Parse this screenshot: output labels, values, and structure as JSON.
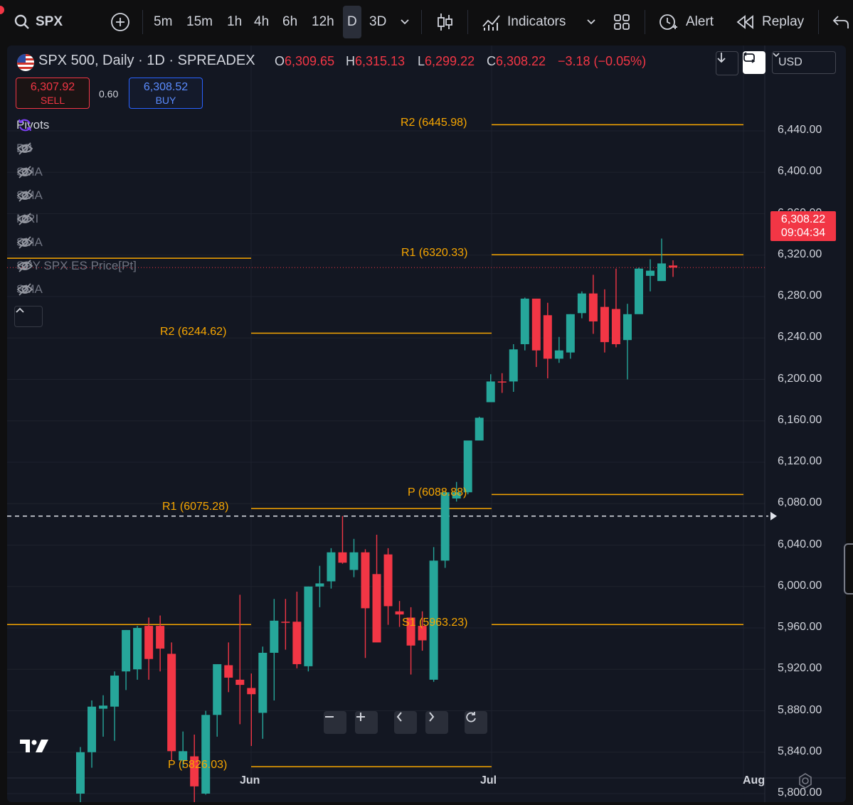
{
  "toolbar": {
    "symbol": "SPX",
    "intervals": [
      "5m",
      "15m",
      "1h",
      "4h",
      "6h",
      "12h",
      "D",
      "3D"
    ],
    "active_interval": "D",
    "indicators_label": "Indicators",
    "alert_label": "Alert",
    "replay_label": "Replay"
  },
  "legend": {
    "title": "SPX 500, Daily · 1D · SPREADEX",
    "open_key": "O",
    "open": "6,309.65",
    "high_key": "H",
    "high": "6,315.13",
    "low_key": "L",
    "low": "6,299.22",
    "close_key": "C",
    "close": "6,308.22",
    "change": "−3.18 (−0.05%)"
  },
  "trade": {
    "sell_price": "6,307.92",
    "sell_label": "SELL",
    "spread": "0.60",
    "buy_price": "6,308.52",
    "buy_label": "BUY"
  },
  "indicators": [
    {
      "label": "Pivots",
      "icon": "refresh-icon",
      "active": true
    },
    {
      "label": "BB",
      "icon": "eye-off-icon",
      "active": false
    },
    {
      "label": "SMA",
      "icon": "eye-off-icon",
      "active": false
    },
    {
      "label": "SMA",
      "icon": "eye-off-icon",
      "active": false
    },
    {
      "label": "MRI",
      "icon": "eye-off-icon",
      "active": false
    },
    {
      "label": "SMA",
      "icon": "eye-off-icon",
      "active": false
    },
    {
      "label": "SPY SPX ES Price[Pt]",
      "icon": "eye-off-icon",
      "active": false
    },
    {
      "label": "SMA",
      "icon": "eye-off-icon",
      "active": false
    }
  ],
  "currency": "USD",
  "price_tag": {
    "price": "6,308.22",
    "countdown": "09:04:34"
  },
  "colors": {
    "up": "#26a69a",
    "down": "#f23645",
    "pivot": "#f7a600",
    "background": "#131722"
  },
  "chart_data": {
    "type": "candlestick",
    "y_ticks": [
      5800,
      5840,
      5880,
      5920,
      5960,
      6000,
      6040,
      6080,
      6120,
      6160,
      6200,
      6240,
      6280,
      6320,
      6360,
      6400,
      6440
    ],
    "y_tick_labels": [
      "5,800.00",
      "5,840.00",
      "5,880.00",
      "5,920.00",
      "5,960.00",
      "6,000.00",
      "6,040.00",
      "6,080.00",
      "6,120.00",
      "6,160.00",
      "6,200.00",
      "6,240.00",
      "6,280.00",
      "6,320.00",
      "6,360.00",
      "6,400.00",
      "6,440.00"
    ],
    "ylim": [
      5780,
      6450
    ],
    "x_labels": [
      "Jun",
      "Jul",
      "Aug"
    ],
    "horizontal_line": 6068,
    "pivots": [
      {
        "label": "R2 (6445.98)",
        "value": 6445.98,
        "period": "Jul"
      },
      {
        "label": "R1 (6320.33)",
        "value": 6320.33,
        "period": "Jul"
      },
      {
        "label": "P (6088.88)",
        "value": 6088.88,
        "period": "Jul"
      },
      {
        "label": "S1 (5963.23)",
        "value": 5963.23,
        "period": "Jul"
      },
      {
        "label": "R2 (6244.62)",
        "value": 6244.62,
        "period": "Jun"
      },
      {
        "label": "R1 (6075.28)",
        "value": 6075.28,
        "period": "Jun"
      },
      {
        "label": "P (5826.03)",
        "value": 5826.03,
        "period": "Jun"
      },
      {
        "label": "",
        "value": 5963.23,
        "period": "May"
      },
      {
        "label": "",
        "value": 6317.0,
        "period": "May"
      }
    ],
    "candles": [
      {
        "o": 5800,
        "h": 5845,
        "l": 5781,
        "c": 5840
      },
      {
        "o": 5840,
        "h": 5890,
        "l": 5825,
        "c": 5884
      },
      {
        "o": 5882,
        "h": 5895,
        "l": 5855,
        "c": 5885
      },
      {
        "o": 5884,
        "h": 5918,
        "l": 5851,
        "c": 5914
      },
      {
        "o": 5918,
        "h": 5958,
        "l": 5900,
        "c": 5958
      },
      {
        "o": 5920,
        "h": 5962,
        "l": 5910,
        "c": 5960
      },
      {
        "o": 5962,
        "h": 5970,
        "l": 5910,
        "c": 5930
      },
      {
        "o": 5962,
        "h": 5972,
        "l": 5918,
        "c": 5940
      },
      {
        "o": 5935,
        "h": 5946,
        "l": 5832,
        "c": 5841
      },
      {
        "o": 5832,
        "h": 5860,
        "l": 5825,
        "c": 5841
      },
      {
        "o": 5836,
        "h": 5857,
        "l": 5781,
        "c": 5807
      },
      {
        "o": 5800,
        "h": 5880,
        "l": 5799,
        "c": 5876
      },
      {
        "o": 5876,
        "h": 5925,
        "l": 5855,
        "c": 5925
      },
      {
        "o": 5924,
        "h": 5946,
        "l": 5898,
        "c": 5912
      },
      {
        "o": 5910,
        "h": 5992,
        "l": 5867,
        "c": 5905
      },
      {
        "o": 5902,
        "h": 5916,
        "l": 5846,
        "c": 5896
      },
      {
        "o": 5878,
        "h": 5942,
        "l": 5853,
        "c": 5936
      },
      {
        "o": 5936,
        "h": 5988,
        "l": 5890,
        "c": 5967
      },
      {
        "o": 5966,
        "h": 5988,
        "l": 5939,
        "c": 5965
      },
      {
        "o": 5966,
        "h": 5995,
        "l": 5921,
        "c": 5925
      },
      {
        "o": 5923,
        "h": 6000,
        "l": 5918,
        "c": 6000
      },
      {
        "o": 6000,
        "h": 6020,
        "l": 5980,
        "c": 6003
      },
      {
        "o": 6005,
        "h": 6037,
        "l": 5998,
        "c": 6033
      },
      {
        "o": 6033,
        "h": 6068,
        "l": 6022,
        "c": 6023
      },
      {
        "o": 6016,
        "h": 6046,
        "l": 6009,
        "c": 6033
      },
      {
        "o": 6033,
        "h": 6036,
        "l": 5931,
        "c": 5979
      },
      {
        "o": 6012,
        "h": 6050,
        "l": 5982,
        "c": 5946
      },
      {
        "o": 6031,
        "h": 6037,
        "l": 5963,
        "c": 5981
      },
      {
        "o": 5976,
        "h": 5986,
        "l": 5961,
        "c": 5973
      },
      {
        "o": 5970,
        "h": 5980,
        "l": 5915,
        "c": 5943
      },
      {
        "o": 5962,
        "h": 5976,
        "l": 5938,
        "c": 5948
      },
      {
        "o": 5910,
        "h": 6038,
        "l": 5908,
        "c": 6025
      },
      {
        "o": 6025,
        "h": 6089,
        "l": 6018,
        "c": 6091
      },
      {
        "o": 6085,
        "h": 6101,
        "l": 6082,
        "c": 6091
      },
      {
        "o": 6091,
        "h": 6126,
        "l": 6089,
        "c": 6141
      },
      {
        "o": 6141,
        "h": 6164,
        "l": 6142,
        "c": 6163
      },
      {
        "o": 6178,
        "h": 6205,
        "l": 6180,
        "c": 6198
      },
      {
        "o": 6198,
        "h": 6206,
        "l": 6187,
        "c": 6197
      },
      {
        "o": 6198,
        "h": 6234,
        "l": 6188,
        "c": 6229
      },
      {
        "o": 6234,
        "h": 6279,
        "l": 6228,
        "c": 6278
      },
      {
        "o": 6278,
        "h": 6278,
        "l": 6212,
        "c": 6228
      },
      {
        "o": 6262,
        "h": 6274,
        "l": 6201,
        "c": 6220
      },
      {
        "o": 6220,
        "h": 6241,
        "l": 6216,
        "c": 6228
      },
      {
        "o": 6226,
        "h": 6263,
        "l": 6220,
        "c": 6263
      },
      {
        "o": 6264,
        "h": 6285,
        "l": 6259,
        "c": 6283
      },
      {
        "o": 6283,
        "h": 6301,
        "l": 6244,
        "c": 6256
      },
      {
        "o": 6270,
        "h": 6287,
        "l": 6226,
        "c": 6236
      },
      {
        "o": 6268,
        "h": 6307,
        "l": 6231,
        "c": 6234
      },
      {
        "o": 6238,
        "h": 6273,
        "l": 6200,
        "c": 6263
      },
      {
        "o": 6263,
        "h": 6308,
        "l": 6268,
        "c": 6307
      },
      {
        "o": 6300,
        "h": 6316,
        "l": 6285,
        "c": 6305
      },
      {
        "o": 6295,
        "h": 6336,
        "l": 6296,
        "c": 6312
      },
      {
        "o": 6310,
        "h": 6315,
        "l": 6299,
        "c": 6308
      }
    ]
  }
}
